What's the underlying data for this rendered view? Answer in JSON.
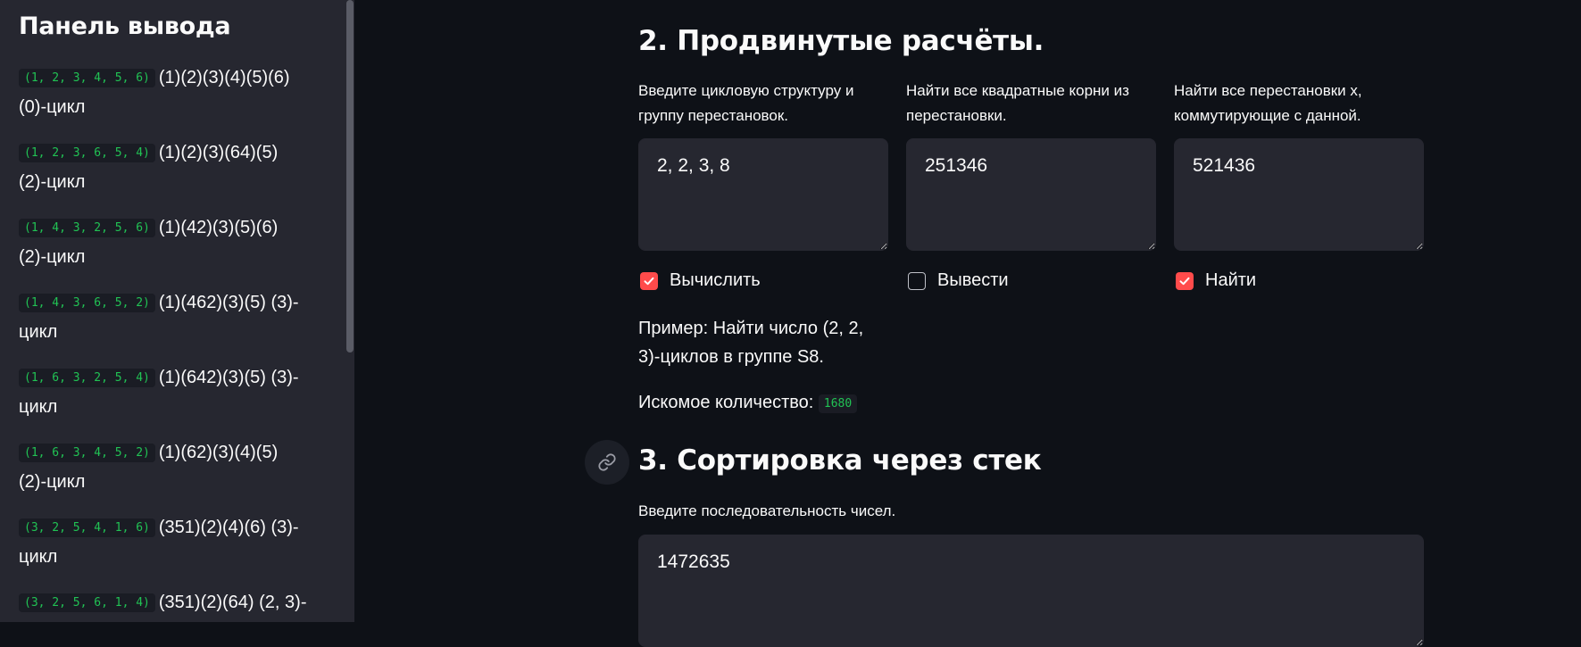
{
  "sidebar": {
    "title": "Панель вывода",
    "items": [
      {
        "code": "(1, 2, 3, 4, 5, 6)",
        "text1": "(1)(2)(3)(4)(5)(6)",
        "text2": "(0)-цикл"
      },
      {
        "code": "(1, 2, 3, 6, 5, 4)",
        "text1": "(1)(2)(3)(64)(5)",
        "text2": "(2)-цикл"
      },
      {
        "code": "(1, 4, 3, 2, 5, 6)",
        "text1": "(1)(42)(3)(5)(6)",
        "text2": "(2)-цикл"
      },
      {
        "code": "(1, 4, 3, 6, 5, 2)",
        "text1": "(1)(462)(3)(5) (3)-",
        "text2": "цикл"
      },
      {
        "code": "(1, 6, 3, 2, 5, 4)",
        "text1": "(1)(642)(3)(5) (3)-",
        "text2": "цикл"
      },
      {
        "code": "(1, 6, 3, 4, 5, 2)",
        "text1": "(1)(62)(3)(4)(5)",
        "text2": "(2)-цикл"
      },
      {
        "code": "(3, 2, 5, 4, 1, 6)",
        "text1": "(351)(2)(4)(6) (3)-",
        "text2": "цикл"
      },
      {
        "code": "(3, 2, 5, 6, 1, 4)",
        "text1": "(351)(2)(64) (2, 3)-",
        "text2": ""
      }
    ]
  },
  "section2": {
    "title": "2. Продвинутые расчёты.",
    "fields": [
      {
        "label_line1": "Введите цикловую структуру и",
        "label_line2": "группу перестановок.",
        "value": "2, 2, 3, 8",
        "checkbox_label": "Вычислить",
        "checked": true
      },
      {
        "label_line1": "Найти все квадратные корни из",
        "label_line2": "перестановки.",
        "value": "251346",
        "checkbox_label": "Вывести",
        "checked": false
      },
      {
        "label_line1": "Найти все перестановки x,",
        "label_line2": "коммутирующие с данной.",
        "value": "521436",
        "checkbox_label": "Найти",
        "checked": true
      }
    ],
    "example_line1": "Пример: Найти число (2, 2,",
    "example_line2": "3)-циклов в группе S8.",
    "result_label": "Искомое количество:",
    "result_value": "1680"
  },
  "section3": {
    "title": "3. Сортировка через стек",
    "label": "Введите последовательность чисел.",
    "value": "1472635"
  },
  "colors": {
    "accent": "#ff4b4b",
    "code_green": "#21c354",
    "sidebar_bg": "#262730",
    "main_bg": "#0e1117"
  },
  "icons": {
    "anchor": "link-icon",
    "check": "checkmark-icon"
  }
}
